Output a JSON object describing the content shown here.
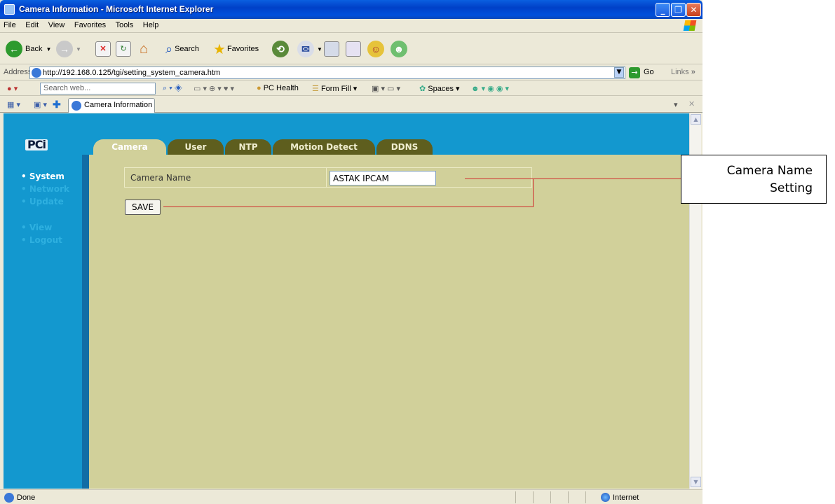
{
  "window": {
    "title": "Camera Information - Microsoft Internet Explorer"
  },
  "menu": [
    "File",
    "Edit",
    "View",
    "Favorites",
    "Tools",
    "Help"
  ],
  "toolbar": {
    "back": "Back",
    "search": "Search",
    "favorites": "Favorites"
  },
  "address": {
    "label": "Address",
    "url": "http://192.168.0.125/tgi/setting_system_camera.htm",
    "go": "Go",
    "links": "Links"
  },
  "searchbar": {
    "placeholder": "Search web...",
    "pc_health": "PC Health",
    "form_fill": "Form Fill",
    "spaces": "Spaces"
  },
  "browser_tab": {
    "label": "Camera Information"
  },
  "page": {
    "logo": "PCi",
    "nav": [
      {
        "label": "System",
        "active": true
      },
      {
        "label": "Network",
        "active": false
      },
      {
        "label": "Update",
        "active": false
      },
      {
        "label": "View",
        "active": false
      },
      {
        "label": "Logout",
        "active": false
      }
    ],
    "tabs": [
      {
        "label": "Camera",
        "active": true
      },
      {
        "label": "User",
        "active": false
      },
      {
        "label": "NTP",
        "active": false
      },
      {
        "label": "Motion Detect",
        "active": false
      },
      {
        "label": "DDNS",
        "active": false
      }
    ],
    "form": {
      "camera_name_label": "Camera Name",
      "camera_name_value": "ASTAK IPCAM",
      "save_label": "SAVE"
    }
  },
  "status": {
    "text": "Done",
    "zone": "Internet"
  },
  "annotation": {
    "line1": "Camera Name",
    "line2": "Setting"
  },
  "colors": {
    "header_blue": "#1398cf",
    "content_bg": "#d1d09a",
    "tab_dark": "#5e5e1e",
    "annotation_line": "#d03030"
  }
}
